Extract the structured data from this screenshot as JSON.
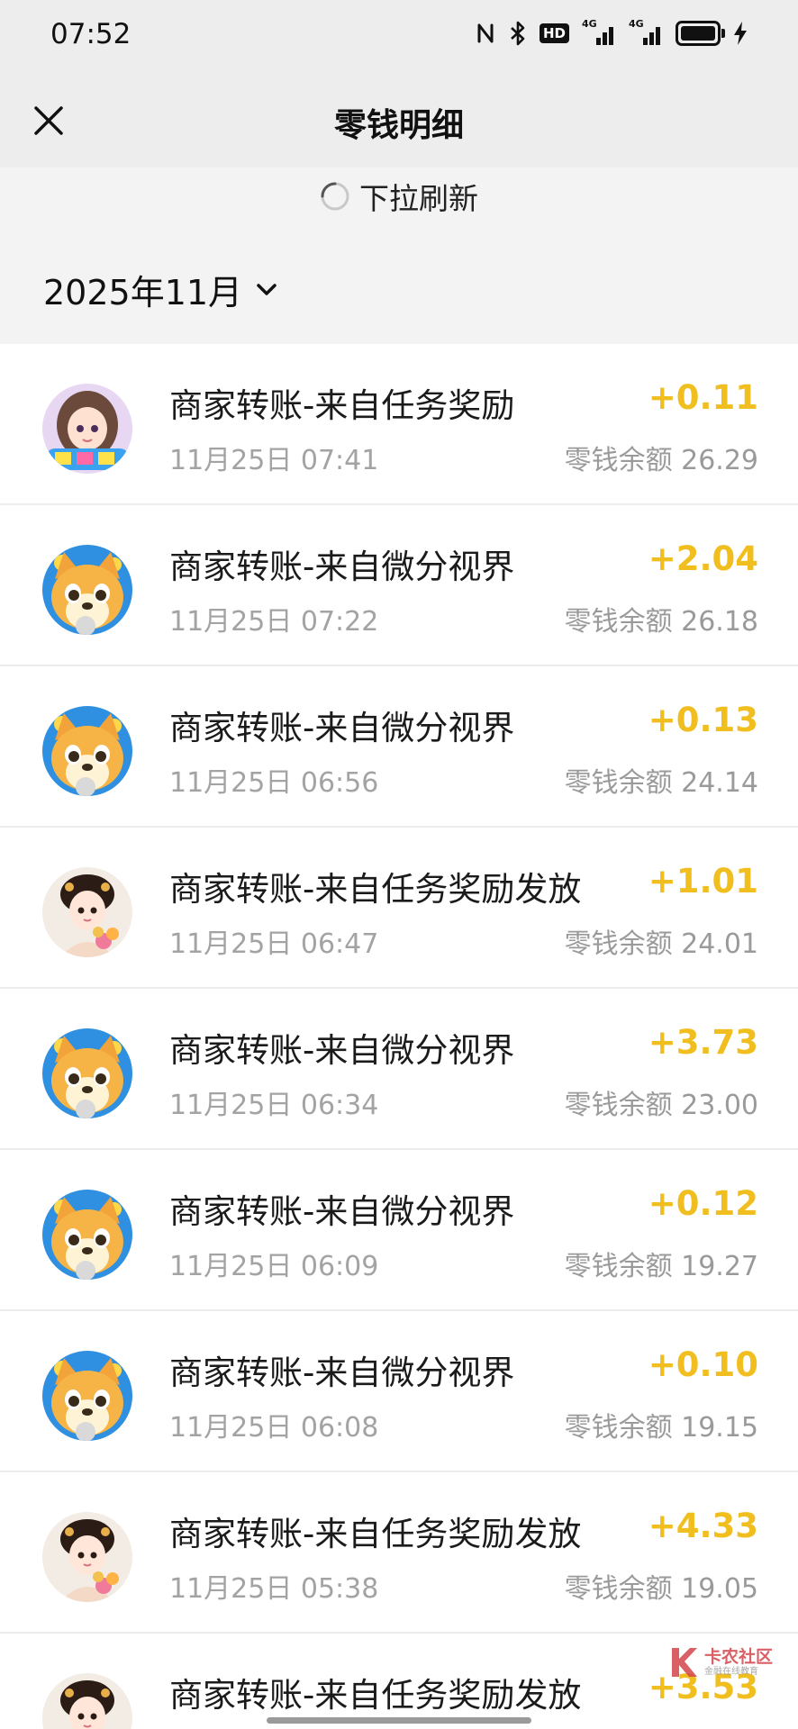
{
  "status_bar": {
    "time": "07:52",
    "icons": [
      "nfc-icon",
      "bluetooth-icon",
      "hd-icon",
      "signal-4g-icon",
      "signal-4g-icon",
      "battery-icon",
      "charging-icon"
    ],
    "hd_label": "HD",
    "network_label": "4G"
  },
  "header": {
    "title": "零钱明细",
    "close_icon": "close-icon"
  },
  "refresh": {
    "label": "下拉刷新"
  },
  "filter": {
    "month": "2025年11月"
  },
  "colors": {
    "amount": "#f0bf1f",
    "background": "#ededed",
    "list_background": "#ffffff"
  },
  "transactions": [
    {
      "avatar": "anime-girl-avatar",
      "title": "商家转账-来自任务奖励",
      "time": "11月25日 07:41",
      "amount": "+0.11",
      "balance": "零钱余额 26.29"
    },
    {
      "avatar": "shiba-dog-avatar",
      "title": "商家转账-来自微分视界",
      "time": "11月25日 07:22",
      "amount": "+2.04",
      "balance": "零钱余额 26.18"
    },
    {
      "avatar": "shiba-dog-avatar",
      "title": "商家转账-来自微分视界",
      "time": "11月25日 06:56",
      "amount": "+0.13",
      "balance": "零钱余额 24.14"
    },
    {
      "avatar": "princess-avatar",
      "title": "商家转账-来自任务奖励发放",
      "time": "11月25日 06:47",
      "amount": "+1.01",
      "balance": "零钱余额 24.01"
    },
    {
      "avatar": "shiba-dog-avatar",
      "title": "商家转账-来自微分视界",
      "time": "11月25日 06:34",
      "amount": "+3.73",
      "balance": "零钱余额 23.00"
    },
    {
      "avatar": "shiba-dog-avatar",
      "title": "商家转账-来自微分视界",
      "time": "11月25日 06:09",
      "amount": "+0.12",
      "balance": "零钱余额 19.27"
    },
    {
      "avatar": "shiba-dog-avatar",
      "title": "商家转账-来自微分视界",
      "time": "11月25日 06:08",
      "amount": "+0.10",
      "balance": "零钱余额 19.15"
    },
    {
      "avatar": "princess-avatar",
      "title": "商家转账-来自任务奖励发放",
      "time": "11月25日 05:38",
      "amount": "+4.33",
      "balance": "零钱余额 19.05"
    },
    {
      "avatar": "princess-avatar",
      "title": "商家转账-来自任务奖励发放",
      "time": "",
      "amount": "+3.53",
      "balance": ""
    }
  ],
  "watermark": {
    "title": "卡农社区",
    "subtitle": "金融在线教育"
  }
}
